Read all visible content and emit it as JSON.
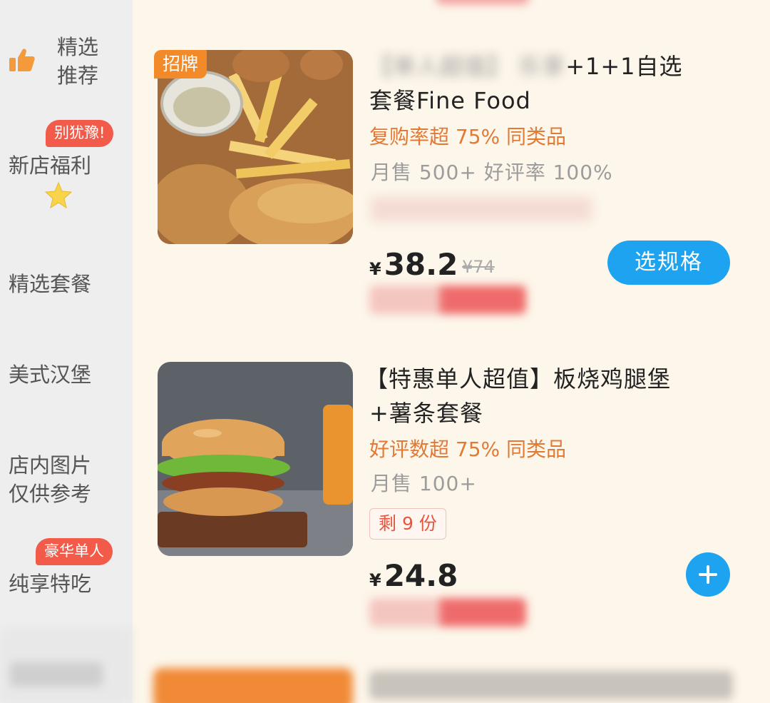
{
  "sidebar": {
    "items": [
      {
        "line1": "精选",
        "line2": "推荐"
      },
      {
        "badge": "别犹豫!",
        "label": "新店福利"
      },
      {
        "label": "精选套餐"
      },
      {
        "label": "美式汉堡"
      },
      {
        "line1": "店内图片",
        "line2": "仅供参考"
      },
      {
        "badge": "豪华单人",
        "label": "纯享特吃"
      }
    ]
  },
  "products": [
    {
      "tag": "招牌",
      "title_line1_visible": "+1+1自选",
      "title_line2": "套餐Fine Food",
      "highlight": "复购率超 75% 同类品",
      "stats": "月售 500+ 好评率 100%",
      "price_symbol": "¥",
      "price": "38.2",
      "original_price": "¥74",
      "action_label": "选规格"
    },
    {
      "title_line1": "【特惠单人超值】板烧鸡腿堡",
      "title_line2": "+薯条套餐",
      "highlight": "好评数超 75% 同类品",
      "stats": "月售 100+",
      "remaining": "剩 9 份",
      "price_symbol": "¥",
      "price": "24.8"
    }
  ],
  "colors": {
    "accent_blue": "#1da3f0",
    "badge_red": "#f25a4a",
    "highlight_orange": "#e27a36",
    "tag_orange": "#f28a2a"
  }
}
